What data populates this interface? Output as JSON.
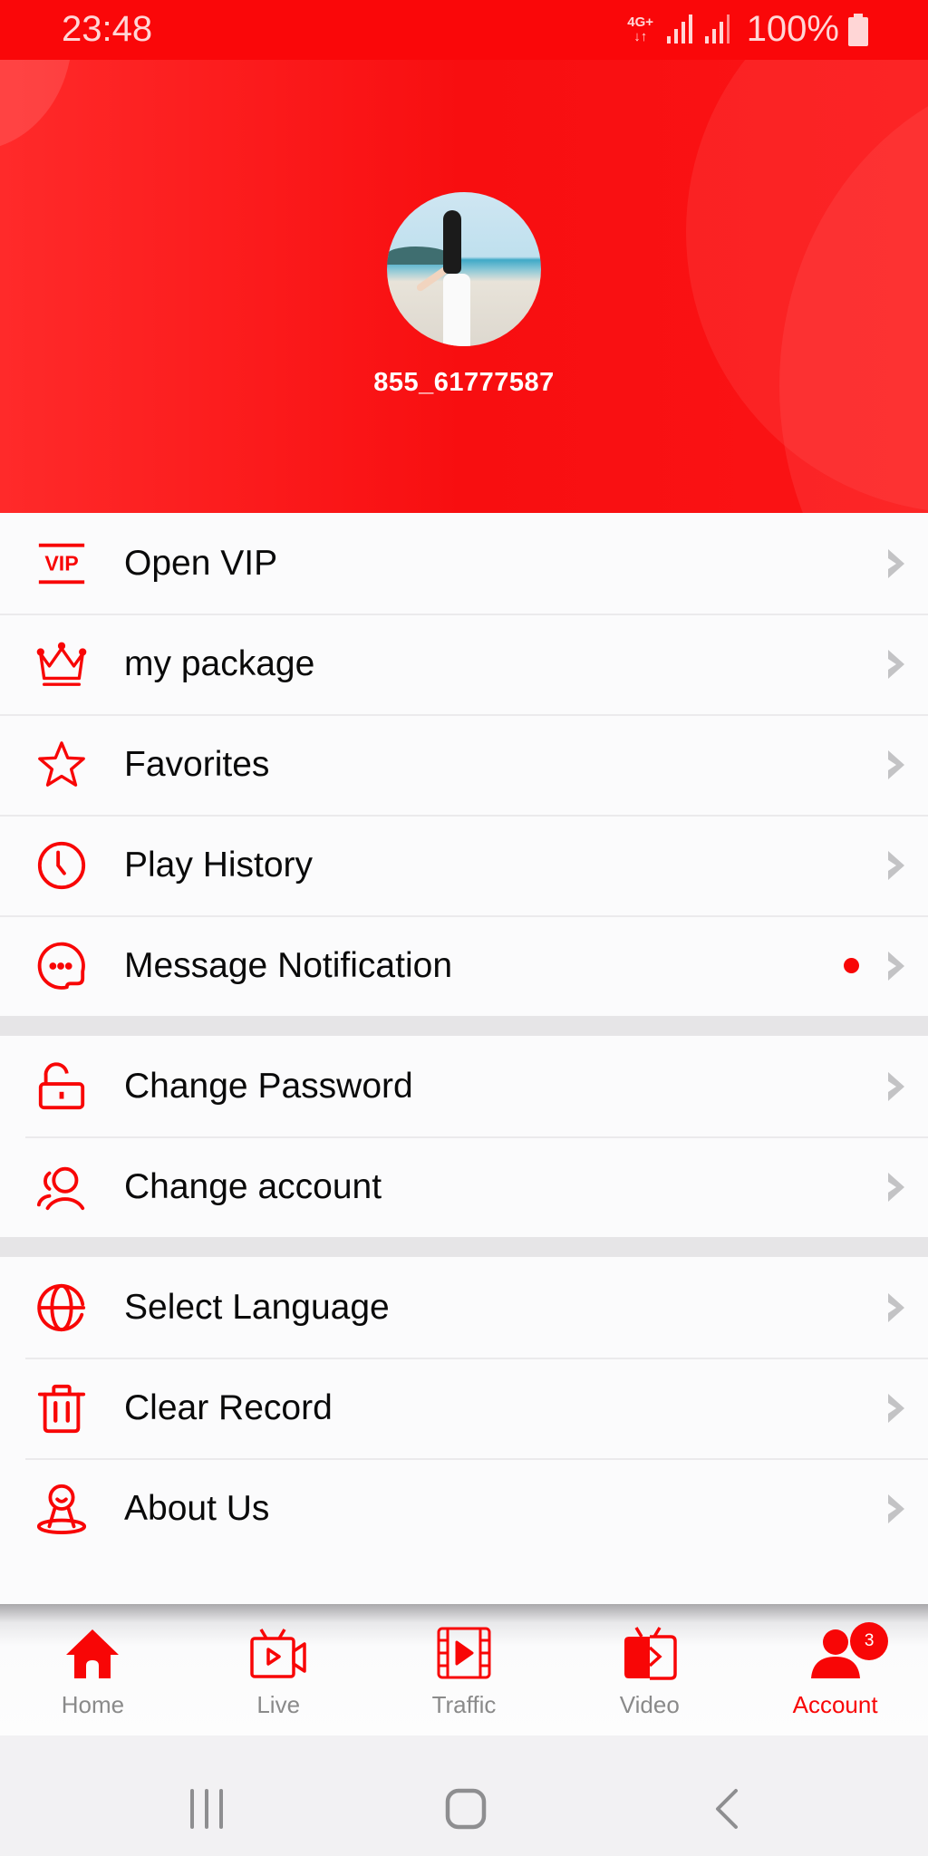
{
  "status_bar": {
    "time": "23:48",
    "network_type": "4G+",
    "battery_percent": "100%",
    "icons": [
      "data-arrows-icon",
      "signal-icon",
      "signal-icon",
      "battery-icon"
    ]
  },
  "profile": {
    "username": "855_61777587",
    "avatar_icon": "avatar-photo"
  },
  "menu_groups": [
    {
      "items": [
        {
          "label": "Open VIP",
          "icon": "vip-icon"
        },
        {
          "label": "my package",
          "icon": "crown-icon"
        },
        {
          "label": "Favorites",
          "icon": "star-icon"
        },
        {
          "label": "Play History",
          "icon": "clock-icon"
        },
        {
          "label": "Message Notification",
          "icon": "chat-bubble-icon",
          "has_unread_dot": true
        }
      ]
    },
    {
      "items": [
        {
          "label": "Change Password",
          "icon": "unlock-icon"
        },
        {
          "label": "Change account",
          "icon": "users-icon"
        }
      ]
    },
    {
      "items": [
        {
          "label": "Select Language",
          "icon": "globe-icon"
        },
        {
          "label": "Clear Record",
          "icon": "trash-icon"
        },
        {
          "label": "About Us",
          "icon": "person-pin-icon"
        }
      ]
    }
  ],
  "bottom_nav": {
    "items": [
      {
        "label": "Home",
        "icon": "home-icon",
        "active": false
      },
      {
        "label": "Live",
        "icon": "tv-camera-icon",
        "active": false
      },
      {
        "label": "Traffic",
        "icon": "film-play-icon",
        "active": false
      },
      {
        "label": "Video",
        "icon": "tv-play-icon",
        "active": false
      },
      {
        "label": "Account",
        "icon": "person-icon",
        "active": true,
        "badge": "3"
      }
    ]
  },
  "system_nav": {
    "buttons": [
      "recent-apps",
      "home",
      "back"
    ]
  },
  "colors": {
    "accent": "#f80606",
    "header_red": "#fa0709",
    "text_primary": "#0a0a0a",
    "text_secondary": "#8a8a8a",
    "chevron": "#c3c3c5",
    "separator_gap": "#e6e5e7"
  }
}
